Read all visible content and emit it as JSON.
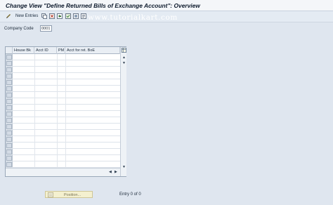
{
  "window": {
    "title": "Change View \"Define Returned Bills of Exchange Account\": Overview"
  },
  "toolbar": {
    "new_entries_label": "New Entries",
    "icons": [
      "edit-icon",
      "copy-icon",
      "delete-icon",
      "undo-icon",
      "select-all-icon",
      "deselect-icon"
    ]
  },
  "watermark": "www.tutorialkart.com",
  "company_code": {
    "label": "Company Code",
    "value": "0001"
  },
  "table": {
    "columns": [
      "House Bk",
      "Acct ID",
      "PM",
      "Acct for ret. BoE"
    ],
    "rows": []
  },
  "footer": {
    "position_button_label": "Position...",
    "entry_status": "Entry 0 of 0"
  },
  "colors": {
    "background": "#dfe6ef",
    "title_text": "#0d1a2c",
    "position_button": "#f4f0cf"
  }
}
